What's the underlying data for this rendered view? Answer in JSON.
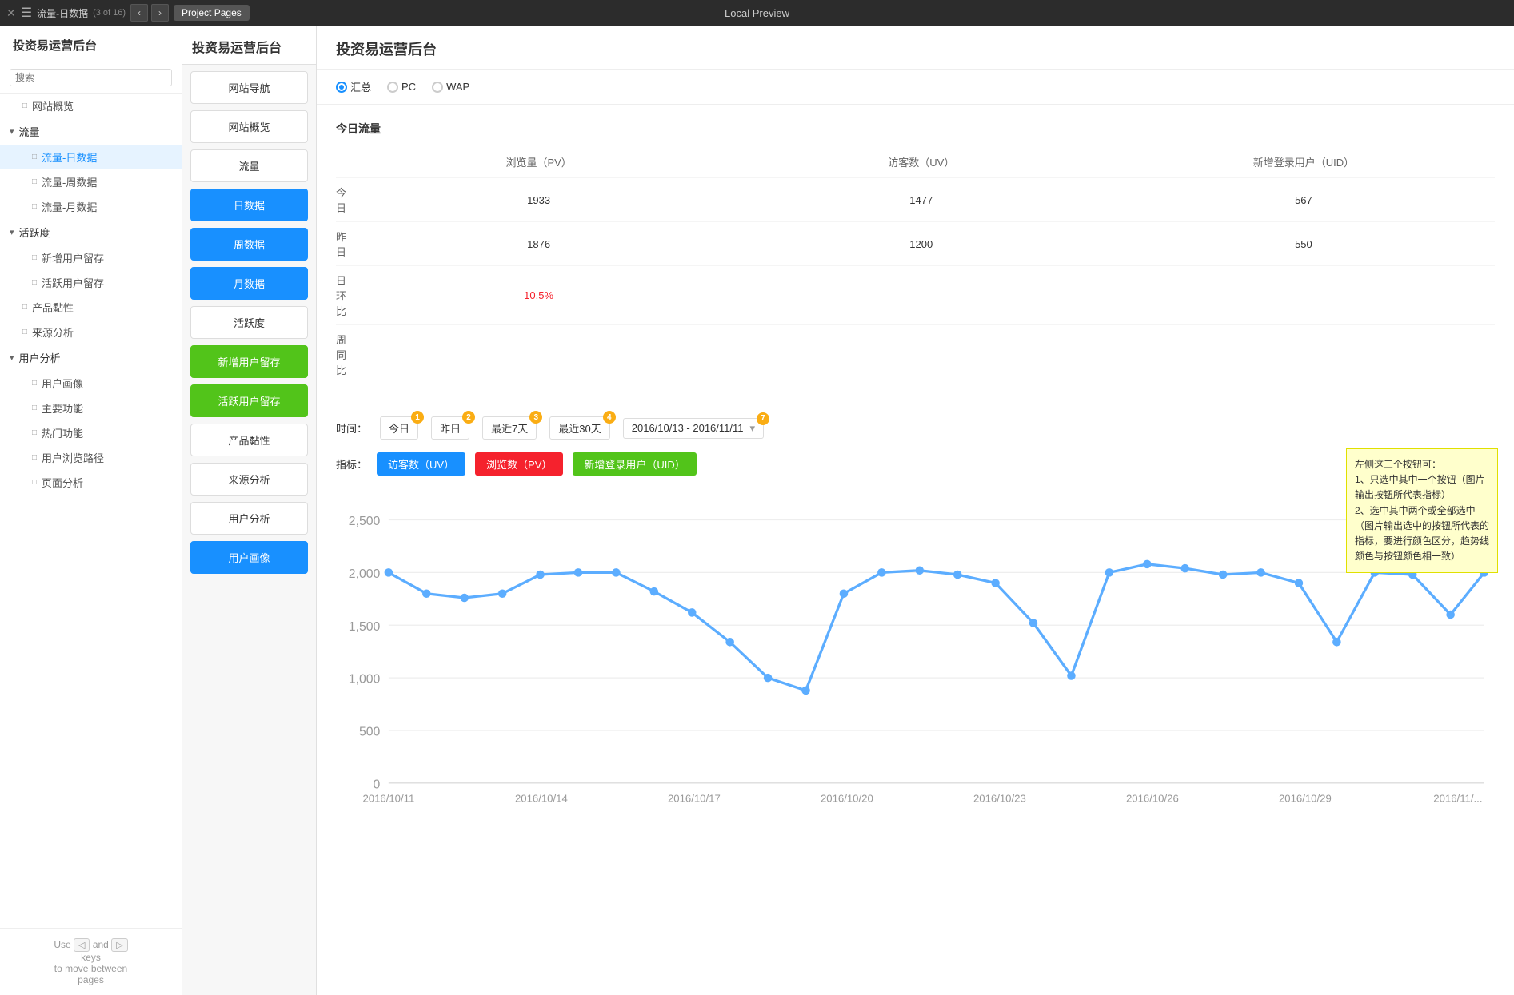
{
  "topBar": {
    "title": "流量-日数据",
    "badge": "(3 of 16)",
    "center": "Local Preview",
    "projectPagesLabel": "Project Pages"
  },
  "sidebar": {
    "appTitle": "投资易运营后台",
    "searchPlaceholder": "搜索",
    "items": [
      {
        "id": "website-overview",
        "label": "网站概览",
        "type": "item",
        "icon": "□"
      },
      {
        "id": "traffic",
        "label": "流量",
        "type": "group",
        "icon": "▾",
        "children": [
          {
            "id": "traffic-daily",
            "label": "流量-日数据",
            "active": true
          },
          {
            "id": "traffic-weekly",
            "label": "流量-周数据"
          },
          {
            "id": "traffic-monthly",
            "label": "流量-月数据"
          }
        ]
      },
      {
        "id": "activity",
        "label": "活跃度",
        "type": "group",
        "icon": "▾",
        "children": [
          {
            "id": "new-user-retention",
            "label": "新增用户留存"
          },
          {
            "id": "active-user-retention",
            "label": "活跃用户留存"
          }
        ]
      },
      {
        "id": "product-stickiness",
        "label": "产品黏性",
        "type": "item",
        "icon": "□"
      },
      {
        "id": "source-analysis",
        "label": "来源分析",
        "type": "item",
        "icon": "□"
      },
      {
        "id": "user-analysis",
        "label": "用户分析",
        "type": "group",
        "icon": "▾",
        "children": [
          {
            "id": "user-profile",
            "label": "用户画像"
          },
          {
            "id": "main-features",
            "label": "主要功能"
          },
          {
            "id": "popular-features",
            "label": "热门功能"
          },
          {
            "id": "user-browse-path",
            "label": "用户浏览路径"
          },
          {
            "id": "page-analysis",
            "label": "页面分析"
          }
        ]
      }
    ],
    "footer": {
      "hint": "Use",
      "leftKey": "◁",
      "and": "and",
      "rightKey": "▷",
      "keysLabel": "keys",
      "toMoveBetween": "to move between",
      "pages": "pages"
    }
  },
  "midPanel": {
    "title": "投资易运营后台",
    "navItems": [
      {
        "id": "website-nav",
        "label": "网站导航",
        "active": false
      },
      {
        "id": "website-overview",
        "label": "网站概览",
        "active": false
      },
      {
        "id": "traffic-section",
        "label": "流量",
        "active": false
      },
      {
        "id": "daily-data",
        "label": "日数据",
        "active": true,
        "style": "blue"
      },
      {
        "id": "weekly-data",
        "label": "周数据",
        "active": true,
        "style": "blue"
      },
      {
        "id": "monthly-data",
        "label": "月数据",
        "active": true,
        "style": "blue"
      },
      {
        "id": "activity-section",
        "label": "活跃度",
        "active": false
      },
      {
        "id": "new-user-retention-btn",
        "label": "新增用户留存",
        "active": true,
        "style": "green"
      },
      {
        "id": "active-user-retention-btn",
        "label": "活跃用户留存",
        "active": true,
        "style": "green"
      },
      {
        "id": "product-stickiness-btn",
        "label": "产品黏性",
        "active": false
      },
      {
        "id": "source-analysis-btn",
        "label": "来源分析",
        "active": false
      },
      {
        "id": "user-analysis-btn",
        "label": "用户分析",
        "active": false
      },
      {
        "id": "user-profile-btn",
        "label": "用户画像",
        "active": true,
        "style": "blue"
      }
    ]
  },
  "mainContent": {
    "title": "投资易运营后台",
    "radioOptions": [
      {
        "id": "total",
        "label": "汇总",
        "checked": true
      },
      {
        "id": "pc",
        "label": "PC",
        "checked": false
      },
      {
        "id": "wap",
        "label": "WAP",
        "checked": false
      }
    ],
    "todayTraffic": {
      "sectionTitle": "今日流量",
      "columns": [
        "",
        "浏览量（PV）",
        "访客数（UV）",
        "新增登录用户（UID）"
      ],
      "rows": [
        {
          "label": "今日",
          "pv": "1933",
          "uv": "1477",
          "uid": "567"
        },
        {
          "label": "昨日",
          "pv": "1876",
          "uv": "1200",
          "uid": "550"
        },
        {
          "label": "日环比",
          "pv": "10.5%",
          "pvRed": true,
          "uv": "",
          "uid": ""
        },
        {
          "label": "周同比",
          "pv": "",
          "uv": "",
          "uid": ""
        }
      ]
    },
    "chartSection": {
      "timeLabel": "时间：",
      "timeBtns": [
        {
          "id": "today",
          "label": "今日",
          "badge": "1"
        },
        {
          "id": "yesterday",
          "label": "昨日",
          "badge": "2"
        },
        {
          "id": "7days",
          "label": "最近7天",
          "badge": "3"
        },
        {
          "id": "30days",
          "label": "最近30天",
          "badge": "4"
        }
      ],
      "dateRange": "2016/10/13 - 2016/11/11",
      "dateRangeBadge": "7",
      "metricLabel": "指标：",
      "metrics": [
        {
          "id": "uv",
          "label": "访客数（UV）",
          "style": "uv"
        },
        {
          "id": "pv",
          "label": "浏览数（PV）",
          "style": "pv"
        },
        {
          "id": "uid",
          "label": "新增登录用户（UID）",
          "style": "uid"
        }
      ],
      "tooltip": {
        "text": "左侧这三个按钮可：\n1、只选中其中一个按钮（图片输出按钮所代表指标）\n2、选中其中两个或全部选中（图片输出选中的按钮所代表的指标，要进行颜色区分，趋势线颜色与按钮颜色相一致）"
      },
      "chartData": {
        "labels": [
          "2016/10/11",
          "2016/10/14",
          "2016/10/17",
          "2016/10/20",
          "2016/10/23",
          "2016/10/26",
          "2016/10/29"
        ],
        "yAxis": [
          0,
          500,
          1000,
          1500,
          2000,
          2500
        ],
        "uvValues": [
          2000,
          1900,
          1850,
          2000,
          2050,
          2100,
          2050,
          1900,
          1700,
          1350,
          1000,
          900,
          1900,
          2100,
          2100,
          2050,
          1950,
          1600,
          1050,
          2100,
          2200,
          2150,
          2050,
          2100,
          1950,
          1350,
          2000,
          1980,
          1500,
          2000
        ]
      }
    }
  }
}
